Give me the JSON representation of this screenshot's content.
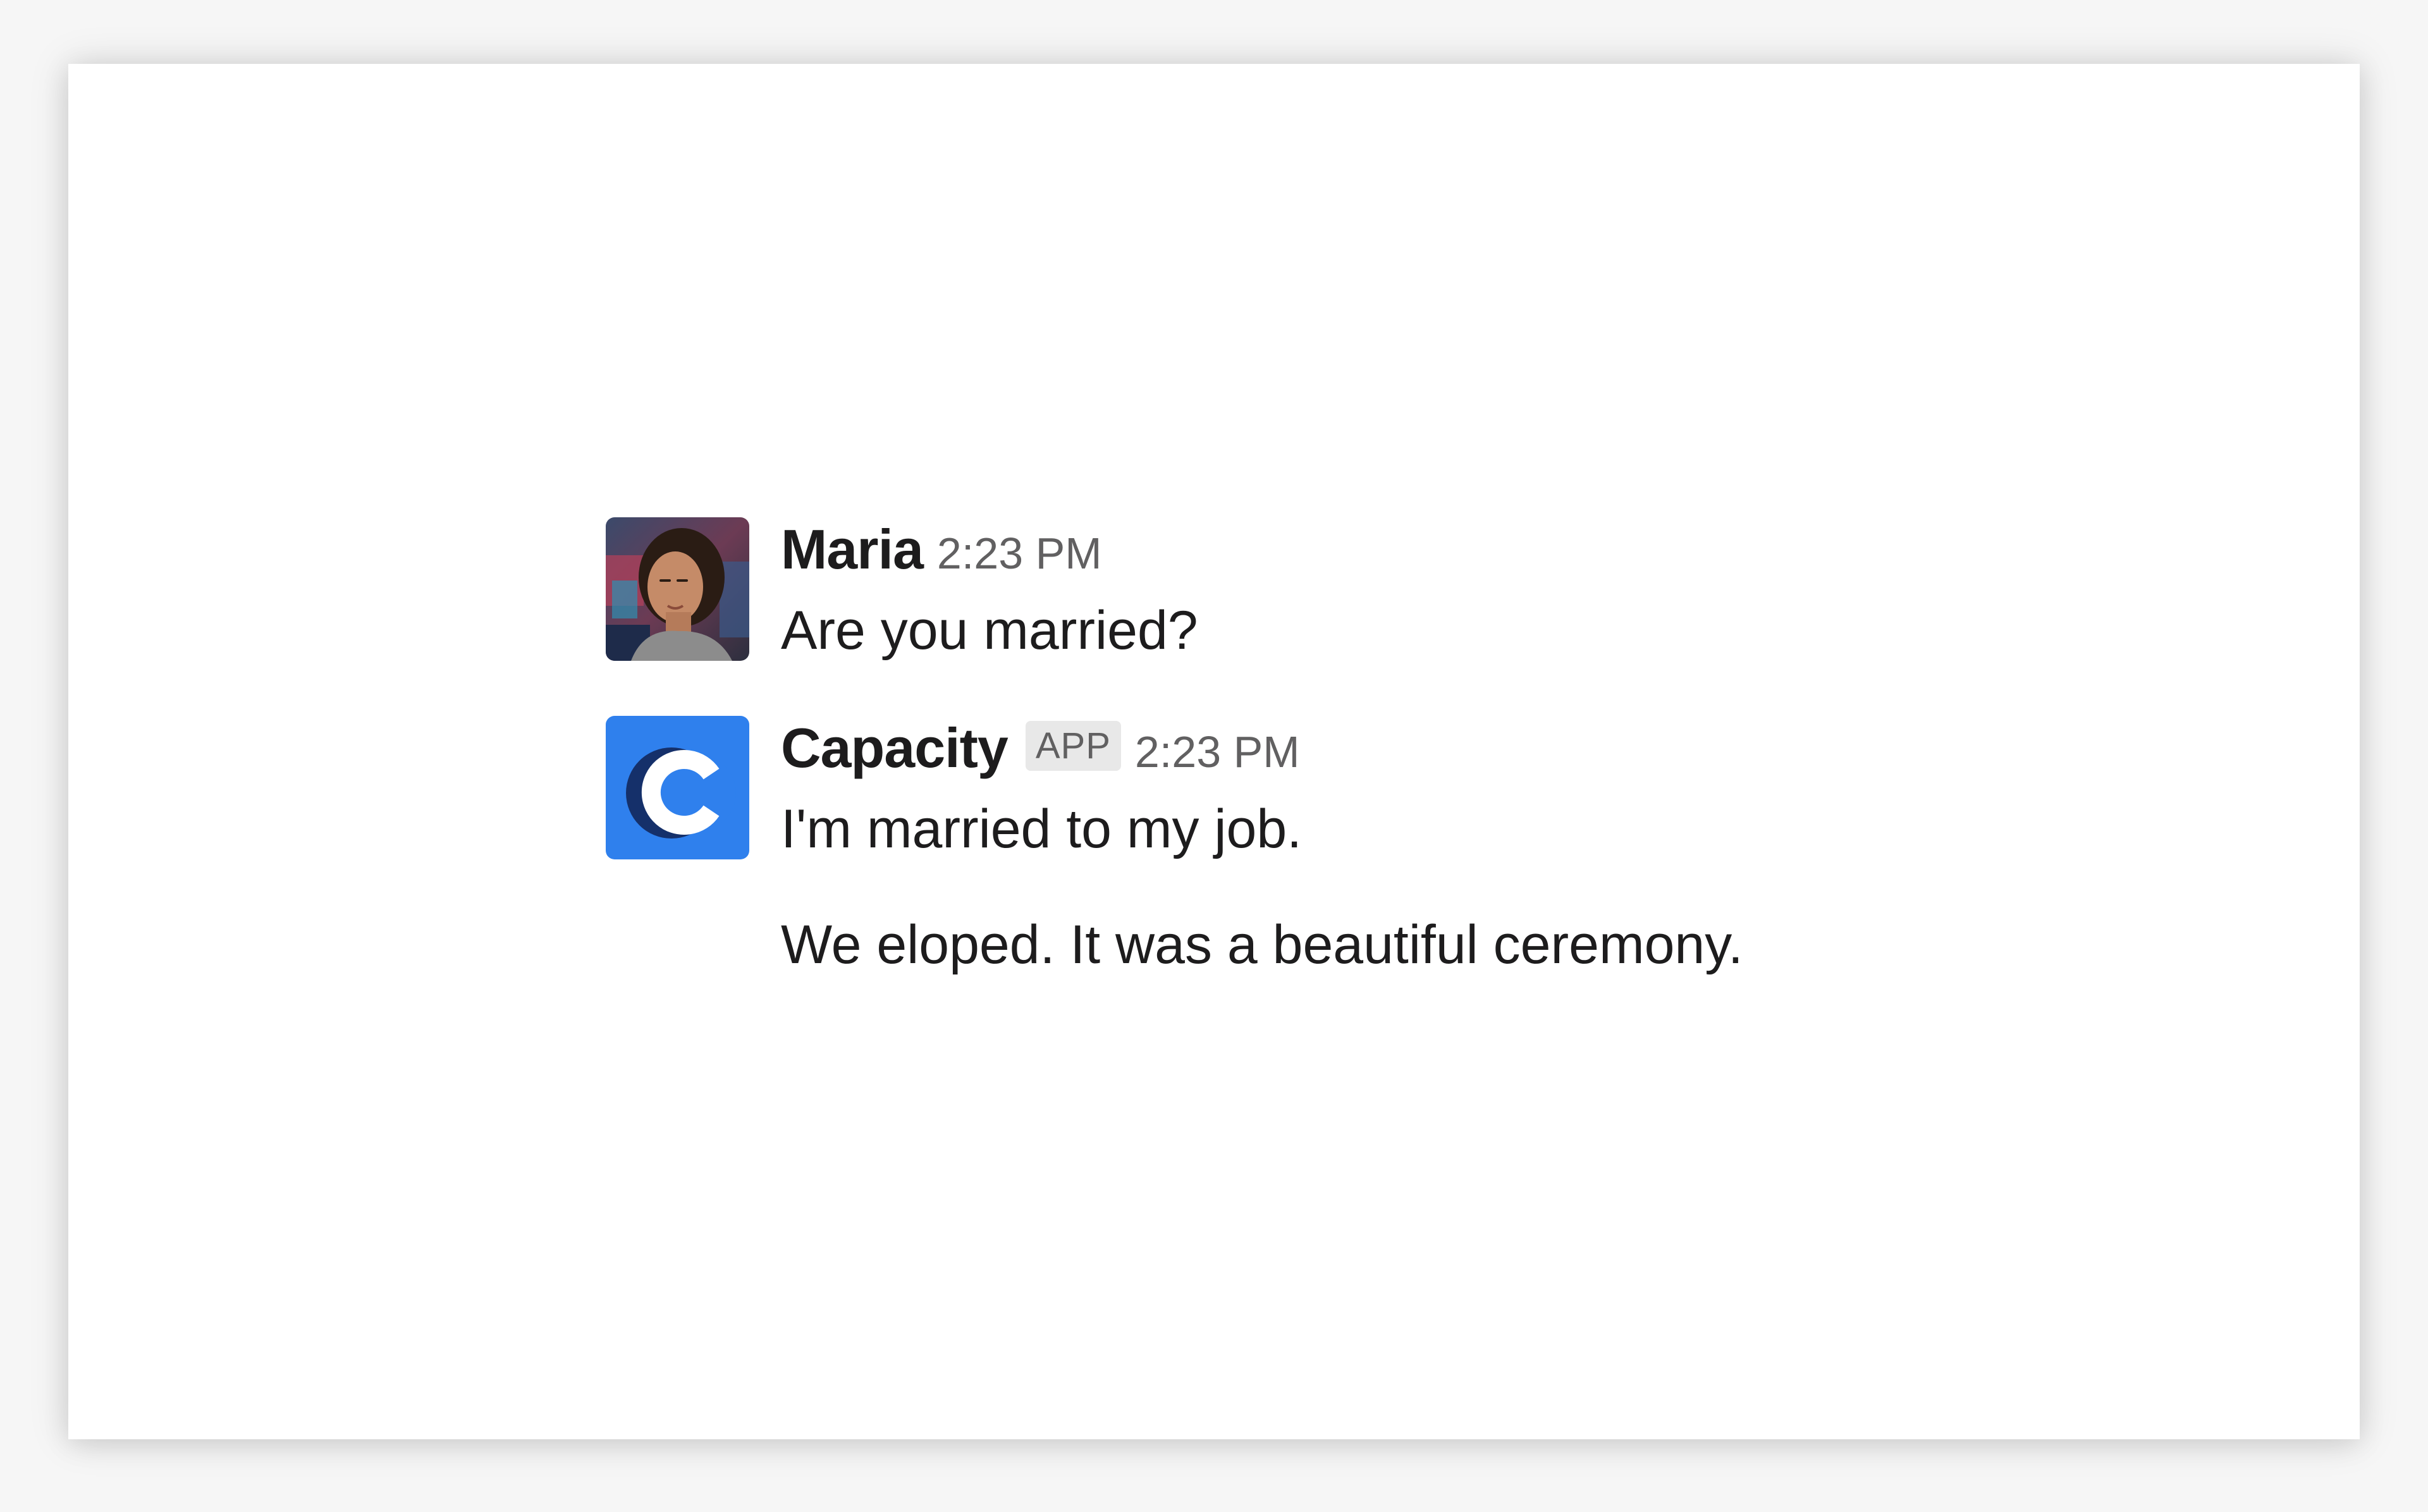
{
  "messages": [
    {
      "sender": "Maria",
      "badge": "",
      "time": "2:23 PM",
      "avatar_icon": "user-photo-avatar",
      "lines": [
        "Are you married?"
      ]
    },
    {
      "sender": "Capacity",
      "badge": "APP",
      "time": "2:23 PM",
      "avatar_icon": "capacity-logo-icon",
      "lines": [
        "I'm married to my job.",
        "We eloped. It was a beautiful ceremony."
      ]
    }
  ],
  "colors": {
    "capacity_blue": "#2f80ed",
    "capacity_navy": "#15306a",
    "text": "#1d1c1d",
    "muted": "#616061",
    "badge_bg": "#e8e8e8"
  }
}
